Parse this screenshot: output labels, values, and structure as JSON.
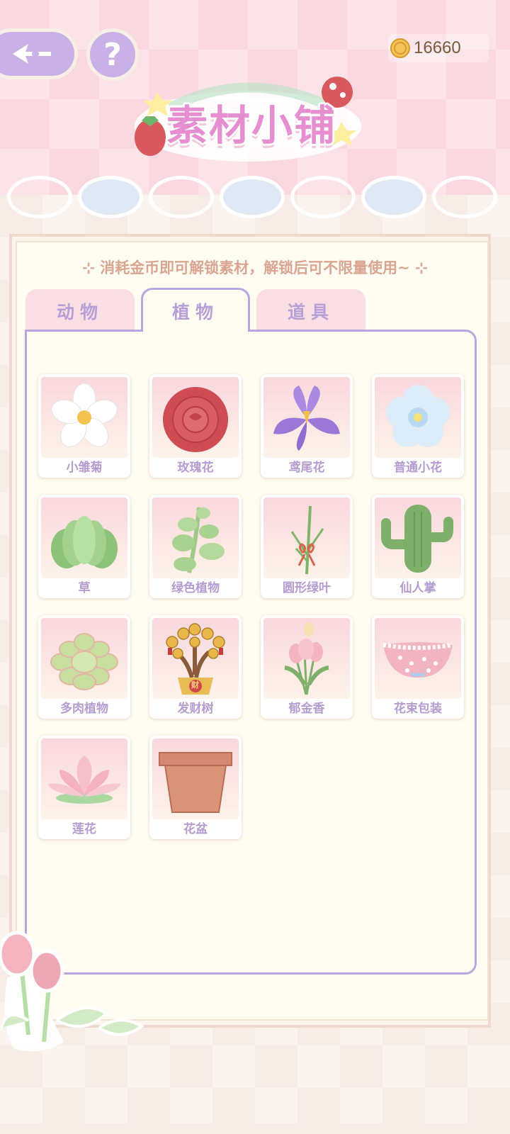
{
  "header": {
    "title": "素材小铺",
    "coins": "16660"
  },
  "notice": "消耗金币即可解锁素材，解锁后可不限量使用~",
  "tabs": [
    {
      "label": "动物",
      "active": false
    },
    {
      "label": "植物",
      "active": true
    },
    {
      "label": "道具",
      "active": false
    }
  ],
  "items": [
    {
      "label": "小雏菊",
      "icon": "daisy-icon"
    },
    {
      "label": "玫瑰花",
      "icon": "rose-icon"
    },
    {
      "label": "鸢尾花",
      "icon": "iris-icon"
    },
    {
      "label": "普通小花",
      "icon": "small-flower-icon"
    },
    {
      "label": "草",
      "icon": "grass-icon"
    },
    {
      "label": "绿色植物",
      "icon": "green-plant-icon"
    },
    {
      "label": "圆形绿叶",
      "icon": "round-leaf-icon"
    },
    {
      "label": "仙人掌",
      "icon": "cactus-icon"
    },
    {
      "label": "多肉植物",
      "icon": "succulent-icon"
    },
    {
      "label": "发财树",
      "icon": "money-tree-icon",
      "badge": "财"
    },
    {
      "label": "郁金香",
      "icon": "tulip-icon"
    },
    {
      "label": "花束包装",
      "icon": "bouquet-wrap-icon"
    },
    {
      "label": "莲花",
      "icon": "lotus-icon"
    },
    {
      "label": "花盆",
      "icon": "flower-pot-icon"
    }
  ],
  "colors": {
    "accent_purple": "#b9a6e1",
    "tab_text": "#b79fd8",
    "title_pink": "#e58fd0",
    "notice_text": "#d9a592"
  }
}
